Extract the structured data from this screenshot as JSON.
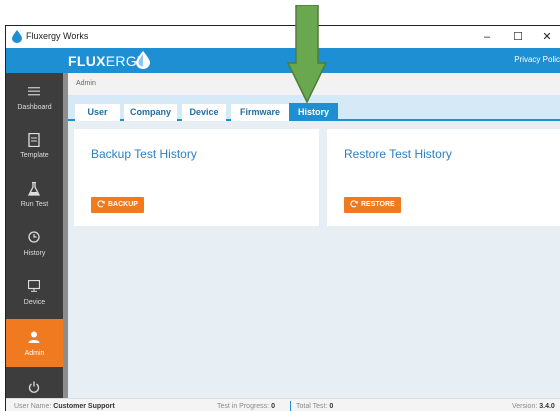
{
  "window": {
    "title": "Fluxergy Works",
    "controls": [
      "–",
      "☐",
      "✕"
    ]
  },
  "header": {
    "logo_bold": "FLUX",
    "logo_light": "ERGY",
    "privacy_link": "Privacy Polic"
  },
  "sidebar": {
    "items": [
      {
        "label": "Dashboard",
        "icon": "menu-icon"
      },
      {
        "label": "Template",
        "icon": "document-icon"
      },
      {
        "label": "Run Test",
        "icon": "flask-icon"
      },
      {
        "label": "History",
        "icon": "history-icon"
      },
      {
        "label": "Device",
        "icon": "monitor-icon"
      },
      {
        "label": "Admin",
        "icon": "user-icon",
        "active": true
      },
      {
        "label": "",
        "icon": "power-icon"
      }
    ]
  },
  "breadcrumb": "Admin",
  "tabs": [
    {
      "label": "User"
    },
    {
      "label": "Company"
    },
    {
      "label": "Device"
    },
    {
      "label": "Firmware"
    },
    {
      "label": "History",
      "active": true
    }
  ],
  "cards": {
    "backup": {
      "title": "Backup Test History",
      "button": "BACKUP"
    },
    "restore": {
      "title": "Restore Test History",
      "button": "RESTORE"
    }
  },
  "status": {
    "user_label": "User Name:",
    "user_value": "Customer Support",
    "progress_label": "Test in Progress:",
    "progress_value": "0",
    "total_label": "Total Test:",
    "total_value": "0",
    "version_label": "Version:",
    "version_value": "3.4.0"
  },
  "colors": {
    "brand_blue": "#1e8fd3",
    "accent_orange": "#f07a20",
    "sidebar_dark": "#3d3d3d",
    "annotation_arrow": "#6aa84f"
  }
}
